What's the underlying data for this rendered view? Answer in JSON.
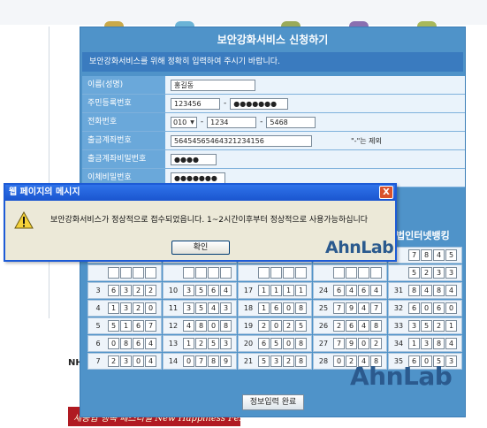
{
  "service": {
    "title": "보안강화서비스 신청하기",
    "notice": "보안강화서비스를 위해 정확히 입력하여 주시기 바랍니다.",
    "name_label": "이름(성명)",
    "name_value": "홍길동",
    "rrn_label": "주민등록번호",
    "rrn_front": "123456",
    "rrn_back": "●●●●●●●",
    "phone_label": "전화번호",
    "phone_prefix": "010",
    "phone_mid": "1234",
    "phone_last": "5468",
    "account_label": "출금계좌번호",
    "account_value": "56454565464321234156",
    "account_note": "\"-\"는 제외",
    "account_pw_label": "출금계좌비밀번호",
    "account_pw_value": "●●●●",
    "hidden_label": "이체비밀번호",
    "hidden_value": "●●●●●●●",
    "dash": "-",
    "card_title": "법인터넷뱅킹",
    "submit": "정보입력 완료"
  },
  "security_card": {
    "rows": [
      [
        {
          "n": "",
          "d": [
            "",
            "",
            "",
            ""
          ]
        },
        {
          "n": "",
          "d": [
            "",
            "",
            "",
            ""
          ]
        },
        {
          "n": "",
          "d": [
            "",
            "",
            "",
            ""
          ]
        },
        {
          "n": "",
          "d": [
            "",
            "",
            "",
            ""
          ]
        },
        {
          "n": "",
          "d": [
            "7",
            "8",
            "4",
            "5"
          ]
        }
      ],
      [
        {
          "n": "",
          "d": [
            "",
            "",
            "",
            ""
          ]
        },
        {
          "n": "",
          "d": [
            "",
            "",
            "",
            ""
          ]
        },
        {
          "n": "",
          "d": [
            "",
            "",
            "",
            ""
          ]
        },
        {
          "n": "",
          "d": [
            "",
            "",
            "",
            ""
          ]
        },
        {
          "n": "",
          "d": [
            "5",
            "2",
            "3",
            "3"
          ]
        }
      ],
      [
        {
          "n": "3",
          "d": [
            "6",
            "3",
            "2",
            "2"
          ]
        },
        {
          "n": "10",
          "d": [
            "3",
            "5",
            "6",
            "4"
          ]
        },
        {
          "n": "17",
          "d": [
            "1",
            "1",
            "1",
            "1"
          ]
        },
        {
          "n": "24",
          "d": [
            "6",
            "4",
            "6",
            "4"
          ]
        },
        {
          "n": "31",
          "d": [
            "8",
            "4",
            "8",
            "4"
          ]
        }
      ],
      [
        {
          "n": "4",
          "d": [
            "1",
            "3",
            "2",
            "0"
          ]
        },
        {
          "n": "11",
          "d": [
            "3",
            "5",
            "4",
            "3"
          ]
        },
        {
          "n": "18",
          "d": [
            "1",
            "6",
            "0",
            "8"
          ]
        },
        {
          "n": "25",
          "d": [
            "7",
            "9",
            "4",
            "7"
          ]
        },
        {
          "n": "32",
          "d": [
            "6",
            "0",
            "6",
            "0"
          ]
        }
      ],
      [
        {
          "n": "5",
          "d": [
            "5",
            "1",
            "6",
            "7"
          ]
        },
        {
          "n": "12",
          "d": [
            "4",
            "8",
            "0",
            "8"
          ]
        },
        {
          "n": "19",
          "d": [
            "2",
            "0",
            "2",
            "5"
          ]
        },
        {
          "n": "26",
          "d": [
            "2",
            "6",
            "4",
            "8"
          ]
        },
        {
          "n": "33",
          "d": [
            "3",
            "5",
            "2",
            "1"
          ]
        }
      ],
      [
        {
          "n": "6",
          "d": [
            "0",
            "8",
            "6",
            "4"
          ]
        },
        {
          "n": "13",
          "d": [
            "1",
            "2",
            "5",
            "3"
          ]
        },
        {
          "n": "20",
          "d": [
            "6",
            "5",
            "0",
            "8"
          ]
        },
        {
          "n": "27",
          "d": [
            "7",
            "9",
            "0",
            "2"
          ]
        },
        {
          "n": "34",
          "d": [
            "1",
            "3",
            "8",
            "4"
          ]
        }
      ],
      [
        {
          "n": "7",
          "d": [
            "2",
            "3",
            "0",
            "4"
          ]
        },
        {
          "n": "14",
          "d": [
            "0",
            "7",
            "8",
            "9"
          ]
        },
        {
          "n": "21",
          "d": [
            "5",
            "3",
            "2",
            "8"
          ]
        },
        {
          "n": "28",
          "d": [
            "0",
            "2",
            "4",
            "8"
          ]
        },
        {
          "n": "35",
          "d": [
            "6",
            "0",
            "5",
            "3"
          ]
        }
      ]
    ]
  },
  "dialog": {
    "title": "웹 페이지의 메시지",
    "message": "보안강화서비스가 정상적으로 접수되었읍니다. 1~2시간이후부터 정상적으로 사용가능하십니다",
    "ok": "확인",
    "close": "X",
    "logo_text": "AhnLab"
  },
  "background": {
    "nh_text": "NH",
    "banner_text": "새농협 행복 페스티벌  New Happiness Festival"
  },
  "footer_logo": "AhnLab",
  "colors": {
    "panel_blue": "#4f93c9",
    "label_blue": "#6aa8da",
    "dialog_title_blue": "#1d5bd6",
    "dialog_body": "#ece9d8",
    "close_red": "#d9512b"
  },
  "icons": {
    "warning": "warning-icon",
    "close": "close-icon",
    "dropdown": "chevron-down-icon"
  }
}
